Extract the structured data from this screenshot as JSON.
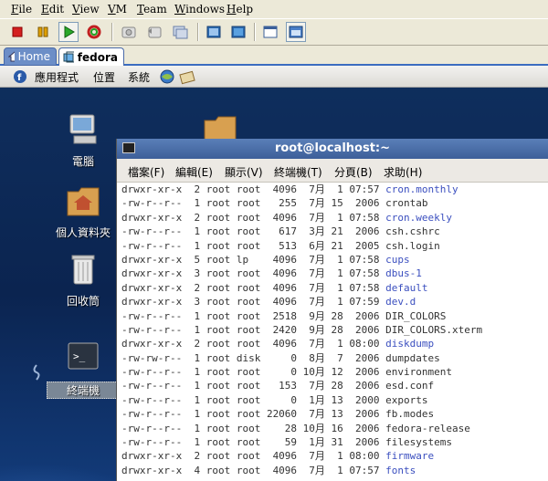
{
  "vm_menu": [
    "File",
    "Edit",
    "View",
    "VM",
    "Team",
    "Windows",
    "Help"
  ],
  "toolbar": {
    "buttons": [
      "stop-icon",
      "pause-icon",
      "play-icon",
      "reset-icon",
      "snapshot-icon",
      "revert-snapshot-icon",
      "snapshot-manager-icon",
      "full-screen-icon",
      "quick-switch-icon",
      "summary-view-icon",
      "console-view-icon"
    ]
  },
  "tabs": {
    "home": "Home",
    "fedora": "fedora"
  },
  "gnome_panel": {
    "apps": "應用程式",
    "places": "位置",
    "system": "系統"
  },
  "desktop": {
    "computer": "電腦",
    "home_folder": "個人資料夾",
    "trash": "回收筒",
    "terminal": "終端機"
  },
  "terminal": {
    "title": "root@localhost:~",
    "menu": [
      "檔案(F)",
      "編輯(E)",
      "顯示(V)",
      "終端機(T)",
      "分頁(B)",
      "求助(H)"
    ],
    "rows": [
      {
        "perm": "drwxr-xr-x",
        "links": "2",
        "owner": "root",
        "group": "root",
        "size": "4096",
        "month": "7月",
        "day": "1",
        "time": "07:57",
        "name": "cron.monthly",
        "dir": true
      },
      {
        "perm": "-rw-r--r--",
        "links": "1",
        "owner": "root",
        "group": "root",
        "size": "255",
        "month": "7月",
        "day": "15",
        "time": "2006",
        "name": "crontab",
        "dir": false
      },
      {
        "perm": "drwxr-xr-x",
        "links": "2",
        "owner": "root",
        "group": "root",
        "size": "4096",
        "month": "7月",
        "day": "1",
        "time": "07:58",
        "name": "cron.weekly",
        "dir": true
      },
      {
        "perm": "-rw-r--r--",
        "links": "1",
        "owner": "root",
        "group": "root",
        "size": "617",
        "month": "3月",
        "day": "21",
        "time": "2006",
        "name": "csh.cshrc",
        "dir": false
      },
      {
        "perm": "-rw-r--r--",
        "links": "1",
        "owner": "root",
        "group": "root",
        "size": "513",
        "month": "6月",
        "day": "21",
        "time": "2005",
        "name": "csh.login",
        "dir": false
      },
      {
        "perm": "drwxr-xr-x",
        "links": "5",
        "owner": "root",
        "group": "lp",
        "size": "4096",
        "month": "7月",
        "day": "1",
        "time": "07:58",
        "name": "cups",
        "dir": true
      },
      {
        "perm": "drwxr-xr-x",
        "links": "3",
        "owner": "root",
        "group": "root",
        "size": "4096",
        "month": "7月",
        "day": "1",
        "time": "07:58",
        "name": "dbus-1",
        "dir": true
      },
      {
        "perm": "drwxr-xr-x",
        "links": "2",
        "owner": "root",
        "group": "root",
        "size": "4096",
        "month": "7月",
        "day": "1",
        "time": "07:58",
        "name": "default",
        "dir": true
      },
      {
        "perm": "drwxr-xr-x",
        "links": "3",
        "owner": "root",
        "group": "root",
        "size": "4096",
        "month": "7月",
        "day": "1",
        "time": "07:59",
        "name": "dev.d",
        "dir": true
      },
      {
        "perm": "-rw-r--r--",
        "links": "1",
        "owner": "root",
        "group": "root",
        "size": "2518",
        "month": "9月",
        "day": "28",
        "time": "2006",
        "name": "DIR_COLORS",
        "dir": false
      },
      {
        "perm": "-rw-r--r--",
        "links": "1",
        "owner": "root",
        "group": "root",
        "size": "2420",
        "month": "9月",
        "day": "28",
        "time": "2006",
        "name": "DIR_COLORS.xterm",
        "dir": false
      },
      {
        "perm": "drwxr-xr-x",
        "links": "2",
        "owner": "root",
        "group": "root",
        "size": "4096",
        "month": "7月",
        "day": "1",
        "time": "08:00",
        "name": "diskdump",
        "dir": true
      },
      {
        "perm": "-rw-rw-r--",
        "links": "1",
        "owner": "root",
        "group": "disk",
        "size": "0",
        "month": "8月",
        "day": "7",
        "time": "2006",
        "name": "dumpdates",
        "dir": false
      },
      {
        "perm": "-rw-r--r--",
        "links": "1",
        "owner": "root",
        "group": "root",
        "size": "0",
        "month": "10月",
        "day": "12",
        "time": "2006",
        "name": "environment",
        "dir": false
      },
      {
        "perm": "-rw-r--r--",
        "links": "1",
        "owner": "root",
        "group": "root",
        "size": "153",
        "month": "7月",
        "day": "28",
        "time": "2006",
        "name": "esd.conf",
        "dir": false
      },
      {
        "perm": "-rw-r--r--",
        "links": "1",
        "owner": "root",
        "group": "root",
        "size": "0",
        "month": "1月",
        "day": "13",
        "time": "2000",
        "name": "exports",
        "dir": false
      },
      {
        "perm": "-rw-r--r--",
        "links": "1",
        "owner": "root",
        "group": "root",
        "size": "22060",
        "month": "7月",
        "day": "13",
        "time": "2006",
        "name": "fb.modes",
        "dir": false
      },
      {
        "perm": "-rw-r--r--",
        "links": "1",
        "owner": "root",
        "group": "root",
        "size": "28",
        "month": "10月",
        "day": "16",
        "time": "2006",
        "name": "fedora-release",
        "dir": false
      },
      {
        "perm": "-rw-r--r--",
        "links": "1",
        "owner": "root",
        "group": "root",
        "size": "59",
        "month": "1月",
        "day": "31",
        "time": "2006",
        "name": "filesystems",
        "dir": false
      },
      {
        "perm": "drwxr-xr-x",
        "links": "2",
        "owner": "root",
        "group": "root",
        "size": "4096",
        "month": "7月",
        "day": "1",
        "time": "08:00",
        "name": "firmware",
        "dir": true
      },
      {
        "perm": "drwxr-xr-x",
        "links": "4",
        "owner": "root",
        "group": "root",
        "size": "4096",
        "month": "7月",
        "day": "1",
        "time": "07:57",
        "name": "fonts",
        "dir": true
      }
    ]
  }
}
